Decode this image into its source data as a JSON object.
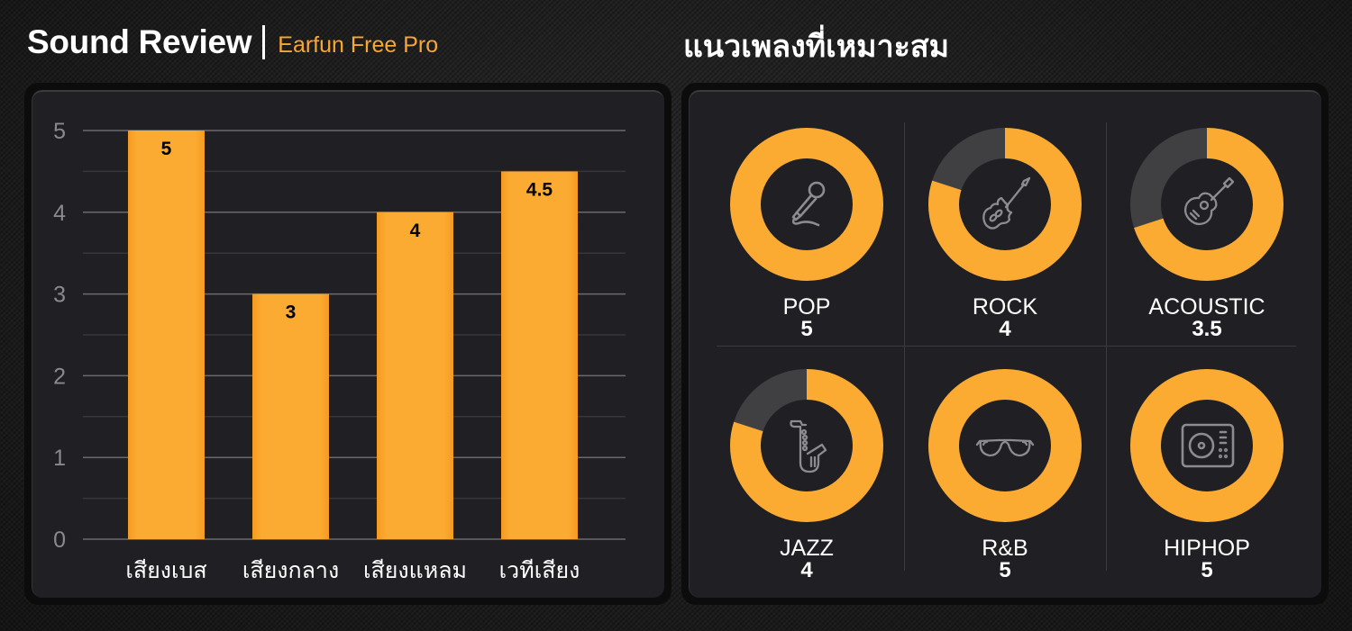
{
  "header": {
    "title": "Sound Review",
    "separator": "|",
    "product": "Earfun Free Pro",
    "genre_heading": "แนวเพลงที่เหมาะสม"
  },
  "colors": {
    "accent": "#f7a733",
    "bar": "#fbab31",
    "donut_track": "#404043",
    "panel": "#202024",
    "grid": "#6a6a6e",
    "axis_text": "#8a8a8e",
    "icon": "#8c8c90"
  },
  "chart_data": {
    "type": "bar",
    "title": "",
    "xlabel": "",
    "ylabel": "",
    "categories": [
      "เสียงเบส",
      "เสียงกลาง",
      "เสียงแหลม",
      "เวทีเสียง"
    ],
    "values": [
      5,
      3,
      4,
      4.5
    ],
    "data_labels": [
      "5",
      "3",
      "4",
      "4.5"
    ],
    "ylim": [
      0,
      5
    ],
    "yticks": [
      0,
      1,
      2,
      3,
      4,
      5
    ],
    "grid": true,
    "minor_grid": true,
    "legend": "none"
  },
  "genres": {
    "max_score": 5,
    "items": [
      {
        "name": "POP",
        "score": 5,
        "score_label": "5",
        "icon": "microphone-icon"
      },
      {
        "name": "ROCK",
        "score": 4,
        "score_label": "4",
        "icon": "electric-guitar-icon"
      },
      {
        "name": "ACOUSTIC",
        "score": 3.5,
        "score_label": "3.5",
        "icon": "acoustic-guitar-icon"
      },
      {
        "name": "JAZZ",
        "score": 4,
        "score_label": "4",
        "icon": "saxophone-icon"
      },
      {
        "name": "R&B",
        "score": 5,
        "score_label": "5",
        "icon": "sunglasses-icon"
      },
      {
        "name": "HIPHOP",
        "score": 5,
        "score_label": "5",
        "icon": "turntable-icon"
      }
    ]
  }
}
